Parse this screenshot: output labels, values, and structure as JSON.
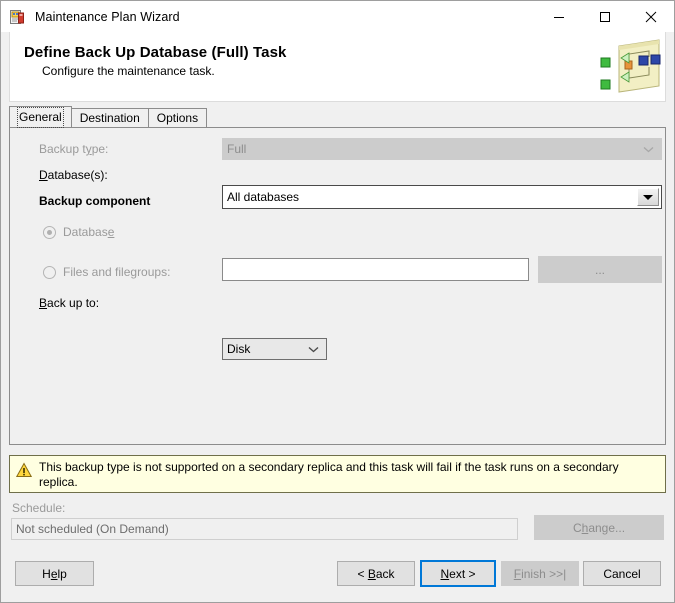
{
  "window": {
    "title": "Maintenance Plan Wizard",
    "icon": "maintenance-plan-icon",
    "controls": {
      "minimize": "minimize-icon",
      "maximize": "maximize-icon",
      "close": "close-icon"
    }
  },
  "banner": {
    "title": "Define Back Up Database (Full) Task",
    "subtitle": "Configure the maintenance task.",
    "icon": "maintenance-plan-diagram-icon"
  },
  "tabs": [
    {
      "label": "General",
      "selected": true
    },
    {
      "label": "Destination",
      "selected": false
    },
    {
      "label": "Options",
      "selected": false
    }
  ],
  "general": {
    "backup_type": {
      "label_pre": "Backup t",
      "label_accel": "y",
      "label_post": "pe:",
      "value": "Full",
      "enabled": false
    },
    "databases": {
      "label_pre": "",
      "label_accel": "D",
      "label_post": "atabase(s):",
      "value": "All databases",
      "enabled": true
    },
    "backup_component_label": "Backup component",
    "radio_database": {
      "label_pre": "Databas",
      "label_accel": "e",
      "label_post": "",
      "selected": true,
      "enabled": false
    },
    "radio_files_filegroups": {
      "label_pre": "Files and file",
      "label_accel": "g",
      "label_post": "roups:",
      "selected": false,
      "enabled": false,
      "textbox_value": "",
      "browse_label": "..."
    },
    "back_up_to": {
      "label_pre": "",
      "label_accel": "B",
      "label_post": "ack up to:",
      "value": "Disk",
      "enabled": true
    }
  },
  "warning": {
    "icon": "warning-triangle-icon",
    "text": "This backup type is not supported on a secondary replica and this task will fail if the task runs on a secondary replica."
  },
  "schedule": {
    "label": "Schedule:",
    "value": "Not scheduled (On Demand)",
    "change_pre": "C",
    "change_accel": "h",
    "change_post": "ange...",
    "change_enabled": false
  },
  "footer": {
    "help": {
      "pre": "H",
      "accel": "e",
      "post": "lp"
    },
    "back": {
      "pre": "< ",
      "accel": "B",
      "post": "ack"
    },
    "next": {
      "pre": "",
      "accel": "N",
      "post": "ext >"
    },
    "finish": {
      "pre": "",
      "accel": "F",
      "post": "inish >>|",
      "enabled": false
    },
    "cancel": {
      "pre": "Cancel",
      "accel": "",
      "post": ""
    }
  },
  "colors": {
    "accent": "#0078d7",
    "warning_bg": "#ffffe1",
    "warning_border": "#6f6f4a",
    "dialog_bg": "#f0f0f0"
  }
}
